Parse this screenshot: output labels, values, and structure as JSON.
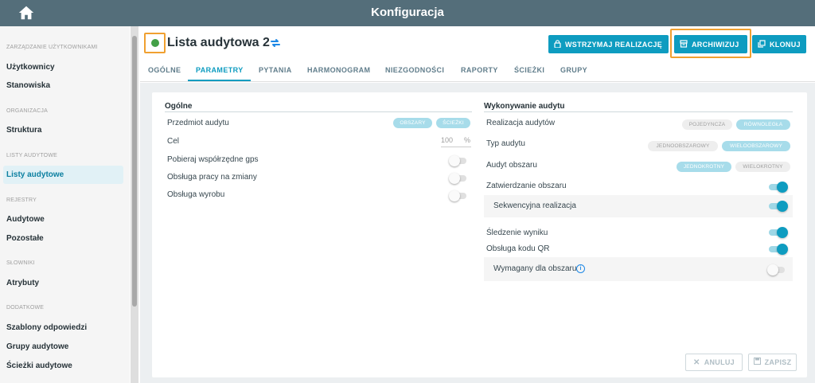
{
  "topbar": {
    "title": "Konfiguracja",
    "home_icon": "home-icon",
    "color": "#546e7a"
  },
  "sidebar": {
    "sections": [
      {
        "label": "ZARZĄDZANIE UŻYTKOWNIKAMI",
        "items": [
          "Użytkownicy",
          "Stanowiska"
        ]
      },
      {
        "label": "ORGANIZACJA",
        "items": [
          "Struktura"
        ]
      },
      {
        "label": "LISTY AUDYTOWE",
        "items": [
          "Listy audytowe"
        ]
      },
      {
        "label": "REJESTRY",
        "items": [
          "Audytowe",
          "Pozostałe"
        ]
      },
      {
        "label": "SŁOWNIKI",
        "items": [
          "Atrybuty"
        ]
      },
      {
        "label": "DODATKOWE",
        "items": [
          "Szablony odpowiedzi",
          "Grupy audytowe",
          "Ścieżki audytowe"
        ]
      }
    ],
    "active_item": "Listy audytowe"
  },
  "header": {
    "title": "Lista audytowa 2",
    "status_color": "#43a047",
    "buttons": {
      "suspend": "WSTRZYMAJ REALIZACJĘ",
      "archive": "ARCHIWIZUJ",
      "clone": "KLONUJ"
    }
  },
  "tabs": [
    "OGÓLNE",
    "PARAMETRY",
    "PYTANIA",
    "HARMONOGRAM",
    "NIEZGODNOŚCI",
    "RAPORTY",
    "ŚCIEŻKI",
    "GRUPY"
  ],
  "active_tab": "PARAMETRY",
  "general": {
    "title": "Ogólne",
    "subject_label": "Przedmiot audytu",
    "subject_options": [
      "OBSZARY",
      "ŚCIEŻKI"
    ],
    "goal_label": "Cel",
    "goal_value": "100",
    "goal_unit": "%",
    "gps_label": "Pobieraj współrzędne gps",
    "gps_on": false,
    "shifts_label": "Obsługa pracy na zmiany",
    "shifts_on": false,
    "product_label": "Obsługa wyrobu",
    "product_on": false
  },
  "execution": {
    "title": "Wykonywanie audytu",
    "realization_label": "Realizacja audytów",
    "realization_options": [
      "POJEDYNCZA",
      "RÓWNOLEGŁA"
    ],
    "realization_selected": "RÓWNOLEGŁA",
    "type_label": "Typ audytu",
    "type_options": [
      "JEDNOOBSZAROWY",
      "WIELOOBSZAROWY"
    ],
    "type_selected": "WIELOOBSZAROWY",
    "area_audit_label": "Audyt obszaru",
    "area_audit_options": [
      "JEDNOKROTNY",
      "WIELOKROTNY"
    ],
    "area_audit_selected": "JEDNOKROTNY",
    "approval_label": "Zatwierdzanie obszaru",
    "approval_on": true,
    "sequential_label": "Sekwencyjna realizacja",
    "sequential_on": true,
    "tracking_label": "Śledzenie wyniku",
    "tracking_on": true,
    "qr_label": "Obsługa kodu QR",
    "qr_on": true,
    "required_label": "Wymagany dla obszaru",
    "required_on": false
  },
  "footer": {
    "cancel": "ANULUJ",
    "save": "ZAPISZ"
  },
  "accent_color": "#0e9cc0",
  "highlight_color": "#f0a030"
}
